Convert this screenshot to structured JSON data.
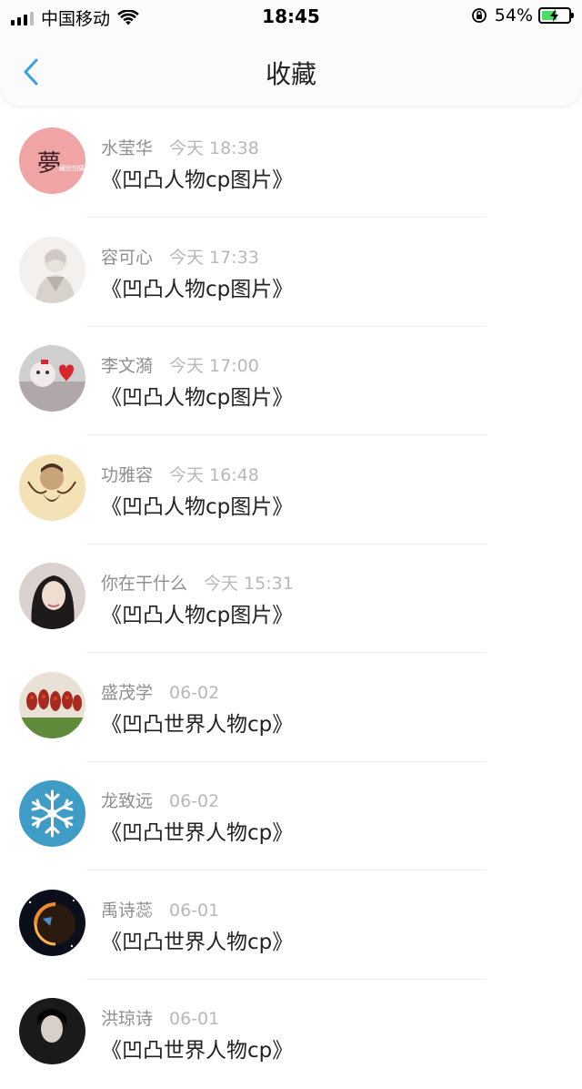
{
  "status_bar": {
    "carrier": "中国移动",
    "time": "18:45",
    "battery": "54%"
  },
  "nav": {
    "title": "收藏"
  },
  "items": [
    {
      "name": "水莹华",
      "time": "今天 18:38",
      "title": "《凹凸人物cp图片》",
      "avatar_text": "夢",
      "avatar_subtext": "藏别怕痛"
    },
    {
      "name": "容可心",
      "time": "今天 17:33",
      "title": "《凹凸人物cp图片》"
    },
    {
      "name": "李文漪",
      "time": "今天 17:00",
      "title": "《凹凸人物cp图片》"
    },
    {
      "name": "功雅容",
      "time": "今天 16:48",
      "title": "《凹凸人物cp图片》"
    },
    {
      "name": "你在干什么",
      "time": "今天 15:31",
      "title": "《凹凸人物cp图片》"
    },
    {
      "name": "盛茂学",
      "time": "06-02",
      "title": "《凹凸世界人物cp》"
    },
    {
      "name": "龙致远",
      "time": "06-02",
      "title": "《凹凸世界人物cp》"
    },
    {
      "name": "禹诗蕊",
      "time": "06-01",
      "title": "《凹凸世界人物cp》"
    },
    {
      "name": "洪琼诗",
      "time": "06-01",
      "title": "《凹凸世界人物cp》"
    }
  ]
}
